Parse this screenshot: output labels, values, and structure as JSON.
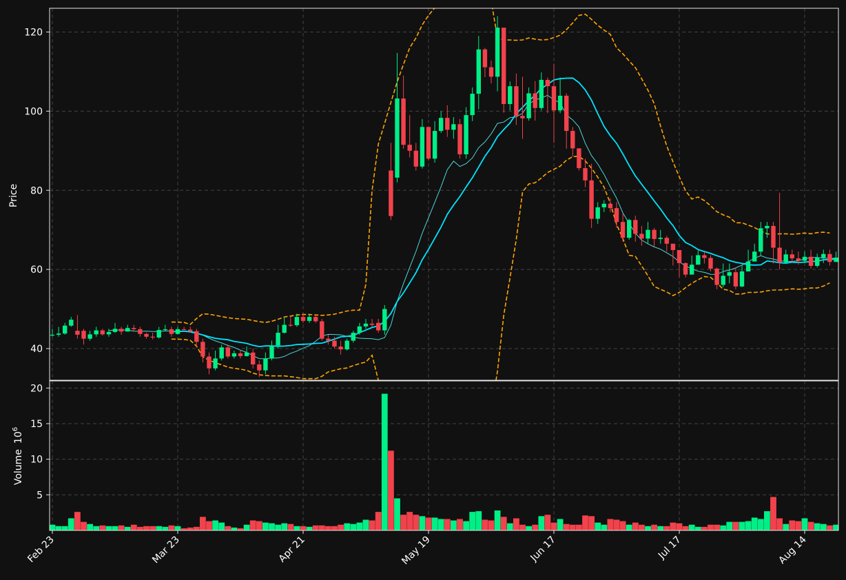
{
  "chart_data": {
    "type": "candlestick",
    "colors": {
      "background": "#111111",
      "up": "#00ef86",
      "down": "#f2424c",
      "band": "#ffa500",
      "ma_long": "#00e5ff",
      "ma_short": "#4fd8d8",
      "grid": "#444444",
      "frame": "#e6e6e6",
      "text": "#ffffff"
    },
    "price_panel": {
      "ylabel": "Price",
      "ylim": [
        32,
        126
      ],
      "yticks": [
        40,
        60,
        80,
        100,
        120
      ]
    },
    "volume_panel": {
      "ylabel": "Volume",
      "ylabel_exponent": "10",
      "ylabel_exponent_power": "6",
      "unit": "millions",
      "ylim": [
        0,
        21
      ],
      "yticks": [
        5,
        10,
        15,
        20
      ],
      "ytick_labels": [
        "5",
        "10",
        "15",
        "20"
      ]
    },
    "x_axis": {
      "tick_indices": [
        0,
        20,
        40,
        60,
        80,
        100,
        120
      ],
      "tick_labels": [
        "Feb 23",
        "Mar 23",
        "Apr 21",
        "May 19",
        "Jun 17",
        "Jul 17",
        "Aug 14"
      ]
    },
    "grid": true,
    "closes": [
      43.5,
      43.8,
      45.8,
      47.3,
      43.5,
      42.5,
      43.6,
      44.6,
      43.6,
      44.2,
      45,
      44.3,
      45.2,
      44.9,
      43.7,
      43,
      42.8,
      44.7,
      44.9,
      43.7,
      44.9,
      44.8,
      44.4,
      41.7,
      38,
      35,
      37.5,
      40.3,
      38,
      38.8,
      38.1,
      39,
      36,
      34.5,
      37.5,
      40.8,
      44,
      46,
      45.9,
      48,
      47,
      48,
      46.9,
      42.5,
      42,
      40.5,
      39.8,
      42,
      44,
      45.6,
      46.3,
      46,
      44.6,
      50,
      73.5,
      103.2,
      91.5,
      90,
      86,
      96,
      88,
      95,
      98.3,
      95.3,
      96.7,
      89.1,
      99,
      104.4,
      115.6,
      111.1,
      108.7,
      121.1,
      101.8,
      106.3,
      98.8,
      98.2,
      104.5,
      100.8,
      107.9,
      106.3,
      100.2,
      103.9,
      95,
      90.6,
      85.6,
      82.5,
      72.8,
      75.7,
      76.6,
      75.5,
      72,
      68,
      72.5,
      69,
      67.8,
      70,
      67.7,
      68,
      66.5,
      64.9,
      61.6,
      58.7,
      61.2,
      63.6,
      62.9,
      60.2,
      56.1,
      58.4,
      59.3,
      55.7,
      59.5,
      62,
      64.5,
      70.4,
      71,
      65.5,
      61.8,
      63.8,
      62.8,
      62.2,
      63.2,
      60.9,
      63,
      63.9,
      61.9,
      63,
      63.8,
      64.1
    ],
    "opens": [
      43.5,
      43.5,
      43.8,
      45.8,
      44.5,
      44.5,
      42.5,
      43.6,
      44.6,
      43.6,
      44.2,
      45,
      44.3,
      45.2,
      44.9,
      43.7,
      43,
      42.8,
      44.7,
      44.9,
      43.7,
      44.9,
      44.8,
      44.4,
      41.7,
      38,
      35,
      37.5,
      40.3,
      38,
      38.8,
      38.1,
      39,
      36,
      34.5,
      37.5,
      40.8,
      44,
      46,
      45.9,
      48,
      47,
      48,
      46.9,
      42.5,
      42,
      40.5,
      39.8,
      42,
      44,
      45.6,
      46.3,
      46.5,
      44.6,
      85,
      83.2,
      103.2,
      91.5,
      90,
      86,
      96,
      88,
      95,
      98.3,
      95.3,
      96.7,
      89.1,
      99,
      104.4,
      115.6,
      111.1,
      108.7,
      121.1,
      101.8,
      106.3,
      98.8,
      98.2,
      104.5,
      100.8,
      107.9,
      106.3,
      100.2,
      103.9,
      95,
      90.6,
      85.6,
      82.5,
      72.8,
      75.7,
      76.6,
      75.5,
      72,
      68,
      72.5,
      69,
      67.8,
      70,
      67.7,
      68,
      66.5,
      64.9,
      61.6,
      58.7,
      61.2,
      63.6,
      62.9,
      60.2,
      56.1,
      58.4,
      59.3,
      55.7,
      59.5,
      62,
      64.5,
      70.4,
      71,
      65.5,
      61.8,
      63.8,
      62.8,
      62.2,
      63.2,
      60.9,
      63,
      63.9,
      61.9,
      63,
      63.8
    ],
    "highs": [
      45,
      45.5,
      46.5,
      48,
      48.5,
      45,
      44.5,
      45.5,
      45,
      45,
      46.5,
      45.5,
      46,
      46,
      45.5,
      44,
      44,
      45.5,
      46,
      45.5,
      45.5,
      45.5,
      45.5,
      45,
      42.5,
      39,
      39.5,
      41,
      41,
      39.5,
      39.5,
      40.5,
      40,
      37,
      39,
      42,
      46,
      48,
      48,
      48.8,
      49,
      48.5,
      48.5,
      47.5,
      43.5,
      43,
      42,
      42.5,
      44.5,
      46.5,
      47.5,
      47.5,
      47.5,
      51,
      92,
      114.7,
      109,
      99,
      92,
      98,
      96,
      97.5,
      100,
      101.5,
      98.5,
      98,
      101,
      106,
      119,
      116,
      112.8,
      124,
      119.4,
      107.5,
      109.5,
      108.7,
      106,
      107.6,
      109.8,
      108.5,
      112,
      108.5,
      104.5,
      96,
      90,
      88,
      86.7,
      77,
      77.5,
      78,
      77,
      74,
      72.8,
      73.6,
      71,
      72,
      70.5,
      70,
      68.5,
      66,
      63.5,
      61.8,
      63.5,
      64.8,
      64.5,
      63.6,
      60.5,
      61.5,
      61.5,
      60.5,
      61,
      65,
      66.5,
      72,
      72,
      72,
      79.4,
      65,
      65,
      64.5,
      64.5,
      65,
      64,
      65,
      65,
      64.5,
      64.2,
      66.6
    ],
    "lows": [
      43,
      43,
      43.5,
      45.5,
      42.5,
      41,
      42,
      43,
      43.3,
      43,
      44,
      43.5,
      44.5,
      44.5,
      43,
      42.5,
      42.3,
      42.5,
      44.5,
      43,
      43.5,
      44.3,
      44,
      40.5,
      36.5,
      33.5,
      34.5,
      37,
      37.5,
      37.5,
      37.5,
      38,
      35,
      32.8,
      33.5,
      37,
      40,
      43.8,
      45.5,
      45.5,
      46.5,
      46.5,
      46.5,
      42,
      41,
      40,
      38.5,
      39.5,
      41.5,
      43.5,
      45,
      45.5,
      44,
      43.5,
      72.5,
      82,
      90.5,
      88.3,
      85,
      85.5,
      87.5,
      87,
      94.5,
      93.5,
      93,
      88,
      88,
      97.5,
      100.5,
      108.6,
      107,
      105,
      99.6,
      100.2,
      96.5,
      93,
      97.6,
      97.6,
      100.2,
      99.5,
      92,
      99.5,
      90.5,
      88.5,
      85,
      80.8,
      70.5,
      71.5,
      74.5,
      74.5,
      70.5,
      67,
      67.5,
      67,
      66,
      66.5,
      65.7,
      66.5,
      64.5,
      61,
      58,
      58,
      59,
      61.5,
      61.5,
      59.5,
      55,
      55.5,
      56.5,
      55,
      55.5,
      61,
      63,
      63.6,
      68,
      61.5,
      60,
      61.5,
      61.7,
      61.2,
      61.6,
      60.2,
      60.5,
      61.6,
      61,
      62.7,
      62.8,
      63.5
    ],
    "volumes": [
      0.8,
      0.6,
      0.6,
      1.7,
      2.6,
      1.2,
      0.9,
      0.6,
      0.7,
      0.6,
      0.6,
      0.7,
      0.5,
      0.8,
      0.5,
      0.6,
      0.6,
      0.6,
      0.5,
      0.7,
      0.6,
      0.3,
      0.4,
      0.5,
      1.9,
      1.3,
      1.4,
      1.1,
      0.6,
      0.4,
      0.3,
      0.8,
      1.4,
      1.3,
      1.1,
      1,
      0.8,
      1,
      0.9,
      0.6,
      0.6,
      0.5,
      0.7,
      0.7,
      0.6,
      0.6,
      0.8,
      1,
      0.9,
      1.1,
      1.5,
      1.4,
      2.6,
      19.2,
      11.2,
      4.5,
      2.2,
      2.6,
      2.2,
      2,
      1.8,
      1.8,
      1.6,
      1.6,
      1.4,
      1.6,
      1.3,
      2.6,
      2.7,
      1.5,
      1.4,
      2.8,
      1.9,
      1,
      1.7,
      0.8,
      0.6,
      0.8,
      2,
      2.2,
      1.1,
      1.6,
      0.9,
      0.8,
      0.8,
      2.1,
      2,
      1.1,
      0.8,
      1.6,
      1.5,
      1.3,
      0.8,
      1.1,
      0.8,
      0.6,
      0.8,
      0.6,
      0.6,
      1.1,
      1,
      0.6,
      0.8,
      0.5,
      0.5,
      0.8,
      0.8,
      0.7,
      1.2,
      1.2,
      1.2,
      1.3,
      1.8,
      1.6,
      2.7,
      4.7,
      1.7,
      0.9,
      1.4,
      1.3,
      1.7,
      1.2,
      1,
      0.9,
      0.7,
      0.8
    ],
    "ma_short": [
      null,
      null,
      null,
      null,
      null,
      null,
      null,
      null,
      null,
      44.55,
      44.66,
      44.71,
      44.65,
      44.41,
      44.34,
      44.4,
      44.32,
      44.33,
      44.46,
      44.4,
      44.38,
      44.43,
      44.35,
      44.05,
      43.4,
      42.61,
      41.94,
      41.42,
      40.79,
      40.28,
      39.6,
      39.03,
      38.19,
      37.47,
      37.43,
      37.62,
      37.6,
      38.02,
      38.81,
      39.36,
      40.12,
      40.73,
      41.86,
      43.15,
      43.6,
      43.55,
      43.48,
      43.08,
      42.86,
      42.62,
      42.55,
      42.48,
      42.25,
      42.79,
      45.93,
      51.9,
      56.4,
      60.52,
      64.56,
      69.15,
      73.07,
      76.96,
      80.94,
      85.24,
      87.38,
      86.01,
      86.75,
      88.19,
      90.78,
      92.23,
      94.27,
      96.89,
      97.24,
      98.34,
      98.55,
      99.47,
      101.82,
      102.87,
      103.29,
      104.01,
      102.85,
      102.12,
      99.06,
      97.79,
      96.01,
      91.87,
      88.78,
      86.66,
      84.02,
      80.91,
      78.01,
      74.29,
      71.67,
      69.15,
      67.43,
      66.49,
      65.69,
      65.12,
      64.18,
      63.26,
      61.91,
      60.89,
      60.15,
      59.55,
      59.26,
      58.78,
      58.73,
      59.49,
      59.86,
      60.38,
      61.11,
      61.98,
      62.82,
      63.47,
      62.89,
      62.63,
      62.19,
      62.07,
      62.02,
      62.18,
      62.65,
      63.05,
      63.01,
      62.87,
      62.85,
      62.76,
      62.69,
      63.08
    ],
    "ma_long": [
      null,
      null,
      null,
      null,
      null,
      null,
      null,
      null,
      null,
      null,
      null,
      null,
      null,
      null,
      null,
      null,
      null,
      null,
      null,
      44.25,
      44.32,
      44.39,
      44.23,
      43.86,
      43.45,
      42.99,
      42.6,
      42.39,
      42.23,
      41.82,
      41.57,
      41.31,
      40.82,
      40.52,
      40.67,
      40.67,
      40.58,
      40.64,
      40.78,
      41.04,
      41.08,
      41.16,
      41.31,
      41.39,
      41.85,
      42.39,
      42.96,
      43.1,
      43.32,
      44.02,
      44.68,
      45.33,
      45.74,
      46.86,
      48.87,
      51.91,
      54.06,
      56.6,
      59.17,
      62.44,
      65.05,
      67.87,
      70.72,
      73.94,
      76.27,
      78.41,
      80.85,
      83.17,
      85.9,
      88.59,
      90.82,
      93.57,
      95.35,
      97.01,
      99.36,
      100.95,
      102.63,
      104.03,
      105.74,
      106.76,
      107.9,
      108.21,
      108.34,
      108.37,
      107.21,
      105.37,
      102.78,
      99.36,
      96.15,
      93.81,
      91.86,
      89.18,
      86.27,
      83.63,
      81.52,
      79.46,
      77.32,
      75.27,
      73.01,
      71.08,
      68.57,
      66.82,
      66.04,
      65.03,
      64.53,
      64.04,
      63.48,
      62.96,
      62.23,
      61.81,
      61.52,
      61.17,
      61.1,
      61.16,
      62.14,
      61.95,
      61.69,
      61.58,
      61.83,
      61.75,
      61.86,
      61.98,
      62.11,
      62.45,
      62.49,
      62.68,
      62.95,
      63.08
    ],
    "band_upper": [
      null,
      null,
      null,
      null,
      null,
      null,
      null,
      null,
      null,
      null,
      null,
      null,
      null,
      null,
      null,
      null,
      null,
      null,
      null,
      46.7,
      46.7,
      46.6,
      46.1,
      47.6,
      48.8,
      48.7,
      48.4,
      48.1,
      47.8,
      47.6,
      47.5,
      47.4,
      47.1,
      46.8,
      46.6,
      46.9,
      47.4,
      48,
      48.2,
      48.5,
      48.6,
      48.6,
      48.5,
      48.4,
      48.5,
      48.7,
      49.1,
      49.5,
      49.7,
      49.7,
      56.2,
      80,
      91.7,
      96.9,
      102.2,
      107.4,
      111.8,
      116,
      118.5,
      121.8,
      124.2,
      126.1,
      127.1,
      128,
      128,
      127.7,
      127,
      126.2,
      126.5,
      127.4,
      127.9,
      118.5,
      118,
      118,
      117.9,
      118,
      118.5,
      118.2,
      118,
      118.1,
      118.6,
      119.2,
      120.6,
      122.3,
      124.2,
      124.5,
      123.2,
      121.7,
      120.5,
      119.4,
      116,
      114.5,
      112.7,
      111,
      108.2,
      105.3,
      101.9,
      96.3,
      91.2,
      87.2,
      83.4,
      79.9,
      77.8,
      78.3,
      77.4,
      76.1,
      74.6,
      73.8,
      73.2,
      71.8,
      71.8,
      71.2,
      70.6,
      69.7,
      69,
      68.8,
      69,
      69,
      68.9,
      69,
      69.2,
      69,
      69.3,
      69.4,
      69.2
    ],
    "band_lower": [
      null,
      null,
      null,
      null,
      null,
      null,
      null,
      null,
      null,
      null,
      null,
      null,
      null,
      null,
      null,
      null,
      null,
      null,
      null,
      42.4,
      42.4,
      42.3,
      42.1,
      40.6,
      37.9,
      37.1,
      36.4,
      35.9,
      35.3,
      35,
      34.8,
      34.5,
      33.8,
      33.4,
      33.2,
      33.1,
      33.1,
      33.1,
      32.9,
      32.7,
      32.4,
      32.4,
      32.4,
      33,
      34.1,
      34.5,
      34.9,
      35.1,
      35.7,
      36.2,
      36.6,
      38.3,
      32,
      14.1,
      2.8,
      0.3,
      -3.1,
      -6.7,
      -8.9,
      -11.9,
      -15.2,
      -17.2,
      -17.6,
      -18,
      -15.8,
      -12.4,
      -8.5,
      -0.4,
      4.9,
      13.8,
      24.3,
      34.3,
      48.4,
      57.9,
      67.6,
      79.6,
      81.6,
      81.9,
      83.1,
      84.5,
      85.3,
      86.1,
      87.6,
      88.5,
      88.6,
      87.4,
      85.6,
      83.3,
      80.8,
      76.7,
      71.4,
      67.8,
      63.6,
      63.3,
      60.9,
      58.4,
      55.7,
      55,
      54.3,
      53.4,
      54.2,
      55.4,
      56.5,
      57.4,
      58.2,
      58,
      56.6,
      55,
      54.7,
      53.8,
      53.8,
      54.2,
      54.2,
      54.3,
      54.6,
      54.8,
      54.8,
      54.9,
      55.1,
      55,
      55.1,
      55.3,
      55.3,
      55.8,
      56.6
    ]
  }
}
